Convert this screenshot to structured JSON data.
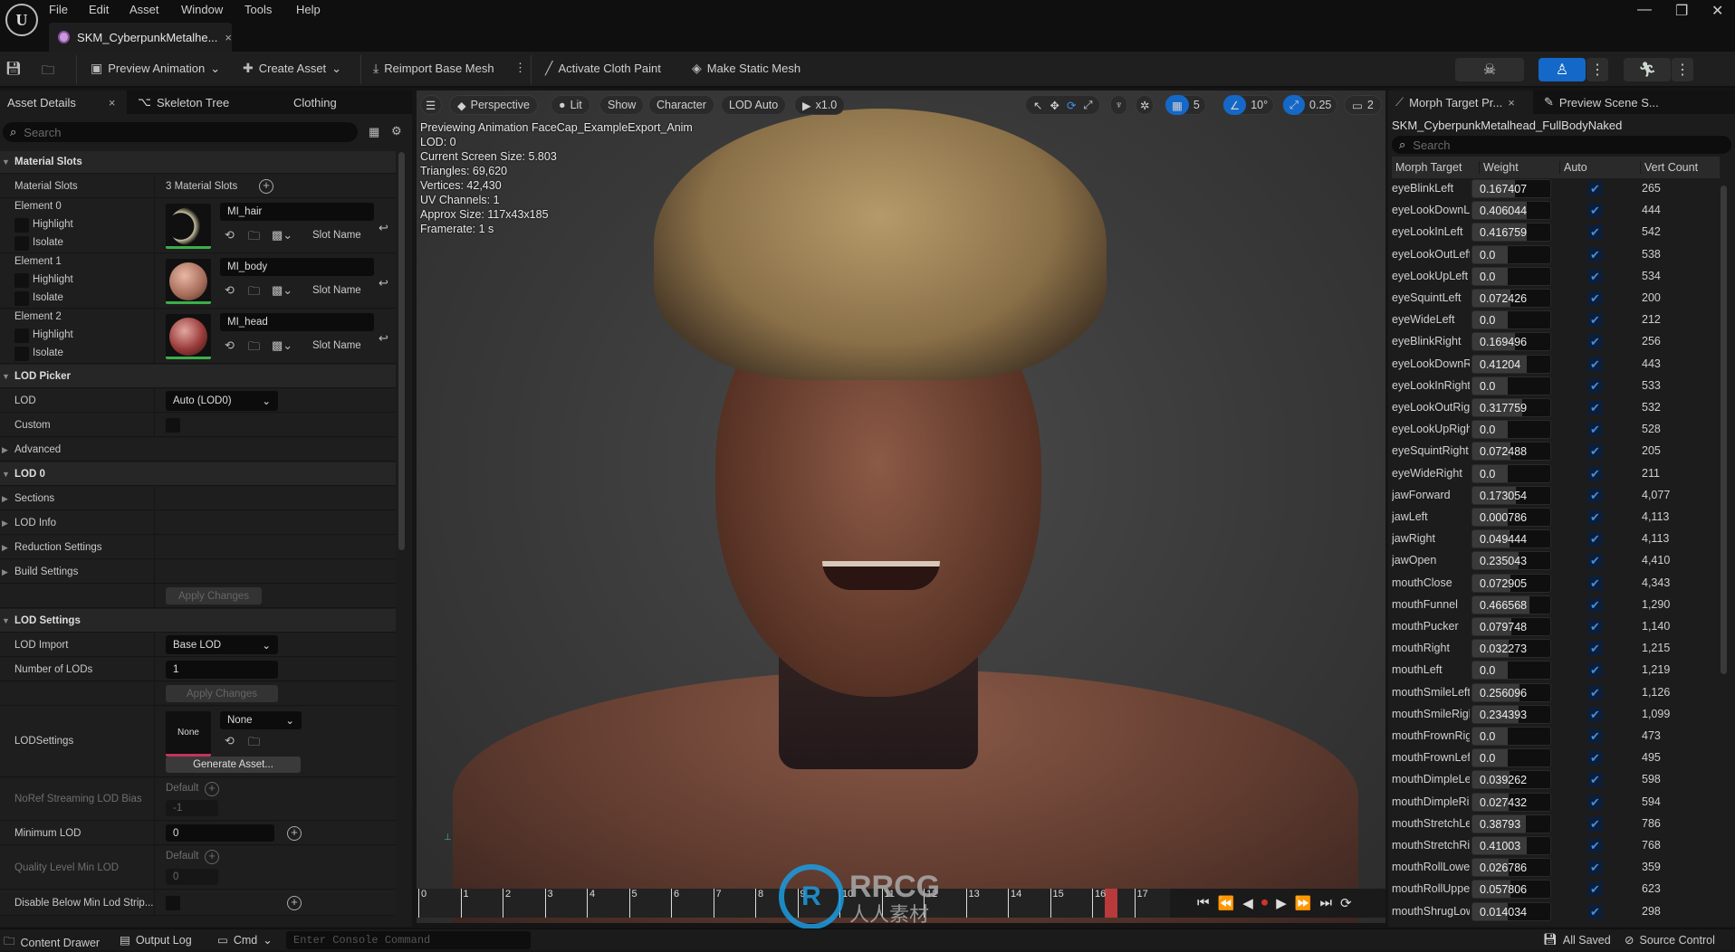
{
  "menu": [
    "File",
    "Edit",
    "Asset",
    "Window",
    "Tools",
    "Help"
  ],
  "document_tab": "SKM_CyberpunkMetalhe...",
  "toolbar": {
    "preview_animation": "Preview Animation",
    "create_asset": "Create Asset",
    "reimport": "Reimport Base Mesh",
    "cloth_paint": "Activate Cloth Paint",
    "static_mesh": "Make Static Mesh"
  },
  "left_panel": {
    "tabs": [
      "Asset Details",
      "Skeleton Tree",
      "Clothing"
    ],
    "search_placeholder": "Search",
    "material_slots": {
      "header": "Material Slots",
      "label": "Material Slots",
      "count": "3 Material Slots",
      "elements": [
        {
          "label": "Element 0",
          "material": "MI_hair"
        },
        {
          "label": "Element 1",
          "material": "MI_body"
        },
        {
          "label": "Element 2",
          "material": "MI_head"
        }
      ],
      "highlight": "Highlight",
      "isolate": "Isolate",
      "slot_name": "Slot Name"
    },
    "lod_picker": {
      "header": "LOD Picker",
      "lod_label": "LOD",
      "lod_value": "Auto (LOD0)",
      "custom": "Custom",
      "advanced": "Advanced"
    },
    "lod0": {
      "header": "LOD 0",
      "items": [
        "Sections",
        "LOD Info",
        "Reduction Settings",
        "Build Settings"
      ],
      "apply": "Apply Changes"
    },
    "lod_settings": {
      "header": "LOD Settings",
      "lod_import": "LOD Import",
      "lod_import_value": "Base LOD",
      "num_lods": "Number of LODs",
      "num_lods_value": "1",
      "apply": "Apply Changes",
      "lodsettings": "LODSettings",
      "lodsettings_thumb": "None",
      "lodsettings_value": "None",
      "generate": "Generate Asset...",
      "noref": "NoRef Streaming LOD Bias",
      "noref_default": "Default",
      "noref_value": "-1",
      "min_lod": "Minimum LOD",
      "min_lod_value": "0",
      "quality": "Quality Level Min LOD",
      "quality_default": "Default",
      "quality_value": "0",
      "disable": "Disable Below Min Lod Strip..."
    }
  },
  "viewport": {
    "buttons": {
      "perspective": "Perspective",
      "lit": "Lit",
      "show": "Show",
      "character": "Character",
      "lod": "LOD Auto",
      "speed": "x1.0",
      "grid": "5",
      "angle": "10°",
      "scale": "0.25",
      "camera": "2"
    },
    "info": [
      "Previewing Animation FaceCap_ExampleExport_Anim",
      "LOD: 0",
      "Current Screen Size: 5.803",
      "Triangles: 69,620",
      "Vertices: 42,430",
      "UV Channels: 1",
      "Approx Size: 117x43x185",
      "Framerate: 1 s"
    ]
  },
  "timeline": {
    "frames": [
      "0",
      "1",
      "2",
      "3",
      "4",
      "5",
      "6",
      "7",
      "8",
      "9",
      "10",
      "11",
      "12",
      "13",
      "14",
      "15",
      "16",
      "17"
    ],
    "current_frame": 16.3,
    "playhead_color": "#b83a3a"
  },
  "watermark": {
    "brand": "RRCG",
    "sub": "人人素材"
  },
  "right_panel": {
    "tabs": [
      "Morph Target Pr...",
      "Preview Scene S..."
    ],
    "mesh_name": "SKM_CyberpunkMetalhead_FullBodyNaked",
    "search_placeholder": "Search",
    "columns": [
      "Morph Target",
      "Weight",
      "Auto",
      "Vert Count"
    ],
    "rows": [
      {
        "name": "eyeBlinkLeft",
        "weight": "0.167407",
        "auto": true,
        "verts": "265"
      },
      {
        "name": "eyeLookDownL",
        "weight": "0.406044",
        "auto": true,
        "verts": "444"
      },
      {
        "name": "eyeLookInLeft",
        "weight": "0.416759",
        "auto": true,
        "verts": "542"
      },
      {
        "name": "eyeLookOutLeft",
        "weight": "0.0",
        "auto": true,
        "verts": "538"
      },
      {
        "name": "eyeLookUpLeft",
        "weight": "0.0",
        "auto": true,
        "verts": "534"
      },
      {
        "name": "eyeSquintLeft",
        "weight": "0.072426",
        "auto": true,
        "verts": "200"
      },
      {
        "name": "eyeWideLeft",
        "weight": "0.0",
        "auto": true,
        "verts": "212"
      },
      {
        "name": "eyeBlinkRight",
        "weight": "0.169496",
        "auto": true,
        "verts": "256"
      },
      {
        "name": "eyeLookDownR",
        "weight": "0.41204",
        "auto": true,
        "verts": "443"
      },
      {
        "name": "eyeLookInRight",
        "weight": "0.0",
        "auto": true,
        "verts": "533"
      },
      {
        "name": "eyeLookOutRight",
        "weight": "0.317759",
        "auto": true,
        "verts": "532"
      },
      {
        "name": "eyeLookUpRight",
        "weight": "0.0",
        "auto": true,
        "verts": "528"
      },
      {
        "name": "eyeSquintRight",
        "weight": "0.072488",
        "auto": true,
        "verts": "205"
      },
      {
        "name": "eyeWideRight",
        "weight": "0.0",
        "auto": true,
        "verts": "211"
      },
      {
        "name": "jawForward",
        "weight": "0.173054",
        "auto": true,
        "verts": "4,077"
      },
      {
        "name": "jawLeft",
        "weight": "0.000786",
        "auto": true,
        "verts": "4,113"
      },
      {
        "name": "jawRight",
        "weight": "0.049444",
        "auto": true,
        "verts": "4,113"
      },
      {
        "name": "jawOpen",
        "weight": "0.235043",
        "auto": true,
        "verts": "4,410"
      },
      {
        "name": "mouthClose",
        "weight": "0.072905",
        "auto": true,
        "verts": "4,343"
      },
      {
        "name": "mouthFunnel",
        "weight": "0.466568",
        "auto": true,
        "verts": "1,290"
      },
      {
        "name": "mouthPucker",
        "weight": "0.079748",
        "auto": true,
        "verts": "1,140"
      },
      {
        "name": "mouthRight",
        "weight": "0.032273",
        "auto": true,
        "verts": "1,215"
      },
      {
        "name": "mouthLeft",
        "weight": "0.0",
        "auto": true,
        "verts": "1,219"
      },
      {
        "name": "mouthSmileLeft",
        "weight": "0.256096",
        "auto": true,
        "verts": "1,126"
      },
      {
        "name": "mouthSmileRight",
        "weight": "0.234393",
        "auto": true,
        "verts": "1,099"
      },
      {
        "name": "mouthFrownRight",
        "weight": "0.0",
        "auto": true,
        "verts": "473"
      },
      {
        "name": "mouthFrownLeft",
        "weight": "0.0",
        "auto": true,
        "verts": "495"
      },
      {
        "name": "mouthDimpleLeft",
        "weight": "0.039262",
        "auto": true,
        "verts": "598"
      },
      {
        "name": "mouthDimpleRight",
        "weight": "0.027432",
        "auto": true,
        "verts": "594"
      },
      {
        "name": "mouthStretchLeft",
        "weight": "0.38793",
        "auto": true,
        "verts": "786"
      },
      {
        "name": "mouthStretchRight",
        "weight": "0.41003",
        "auto": true,
        "verts": "768"
      },
      {
        "name": "mouthRollLower",
        "weight": "0.026786",
        "auto": true,
        "verts": "359"
      },
      {
        "name": "mouthRollUpper",
        "weight": "0.057806",
        "auto": true,
        "verts": "623"
      },
      {
        "name": "mouthShrugLower",
        "weight": "0.014034",
        "auto": true,
        "verts": "298"
      }
    ]
  },
  "bottom_bar": {
    "content_drawer": "Content Drawer",
    "output_log": "Output Log",
    "cmd": "Cmd",
    "console_placeholder": "Enter Console Command",
    "saved": "All Saved",
    "source_control": "Source Control"
  },
  "colors": {
    "accent": "#1468c8",
    "check": "#3d8fe8",
    "slot_ok": "#3cae4b"
  }
}
